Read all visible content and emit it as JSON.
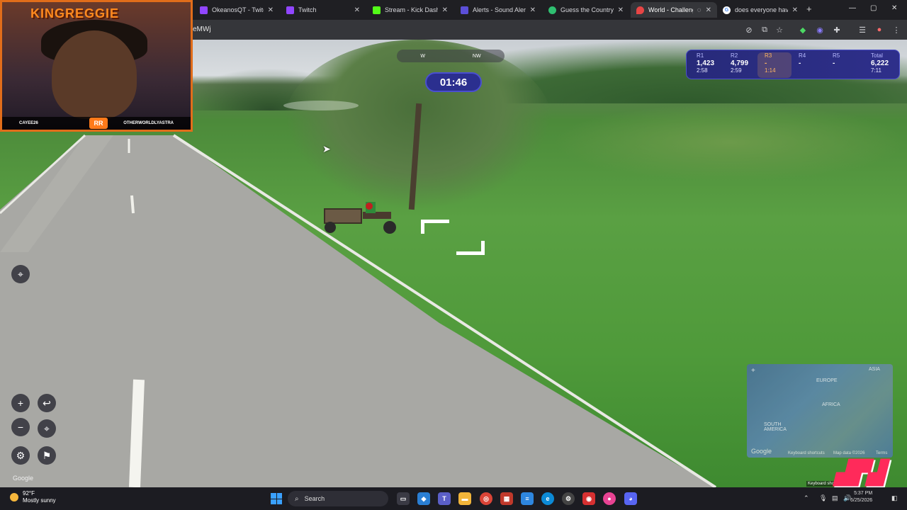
{
  "browser": {
    "tabs": [
      {
        "title": "",
        "favicon_color": "#9146ff",
        "active": false
      },
      {
        "title": "OkeanosQT - Twitch",
        "favicon_color": "#9146ff",
        "active": false
      },
      {
        "title": "Twitch",
        "favicon_color": "#9146ff",
        "active": false
      },
      {
        "title": "Stream - Kick Dashbo",
        "favicon_color": "#53fc18",
        "active": false
      },
      {
        "title": "Alerts - Sound Alerts",
        "favicon_color": "#5b4fd8",
        "active": false
      },
      {
        "title": "Guess the Country",
        "favicon_color": "#2fbf71",
        "active": false
      },
      {
        "title": "World - Challeng",
        "favicon_color": "#e84545",
        "active": true
      },
      {
        "title": "does everyone have",
        "favicon_color": "#ffffff",
        "active": false
      }
    ],
    "close_glyph": "✕",
    "new_tab": "+",
    "url": "eMWj",
    "window_controls": {
      "minimize": "—",
      "maximize": "▢",
      "close": "✕"
    }
  },
  "game": {
    "timer": "01:46",
    "compass": [
      "W",
      "NW"
    ],
    "rounds": [
      {
        "label": "R1",
        "points": "1,423",
        "time": "2:58",
        "current": false
      },
      {
        "label": "R2",
        "points": "4,799",
        "time": "2:59",
        "current": false
      },
      {
        "label": "R3",
        "points": "-",
        "time": "1:14",
        "current": true
      },
      {
        "label": "R4",
        "points": "-",
        "time": "",
        "current": false
      },
      {
        "label": "R5",
        "points": "-",
        "time": "",
        "current": false
      },
      {
        "label": "Total",
        "points": "6,222",
        "time": "7:11",
        "current": false
      }
    ],
    "controls": {
      "zoom_in": "+",
      "zoom_out": "−",
      "undo": "↩",
      "return_to_start": "⌖",
      "settings": "⚙",
      "flag": "⚑",
      "pin": "⌖"
    },
    "minimap": {
      "labels": [
        "EUROPE",
        "AFRICA",
        "SOUTH AMERICA",
        "ASIA"
      ],
      "footer": [
        "Google",
        "Keyboard shortcuts",
        "Map data ©2026",
        "Terms"
      ],
      "expand": "+"
    },
    "google_logo": "Google",
    "keyboard_shortcuts": "Keyboard shortcuts"
  },
  "webcam": {
    "title": "KINGREGGIE",
    "left_name": "CAYEE26",
    "right_name": "OTHERWORLDLYASTRA",
    "badge": "RR"
  },
  "taskbar": {
    "temperature": "92°F",
    "condition": "Mostly sunny",
    "search": "Search",
    "time": "5:37 PM",
    "date": "6/25/2026"
  },
  "colors": {
    "accent": "#2b2f8f",
    "current_round": "#ffb562",
    "webcam_border": "#e16d1a"
  }
}
